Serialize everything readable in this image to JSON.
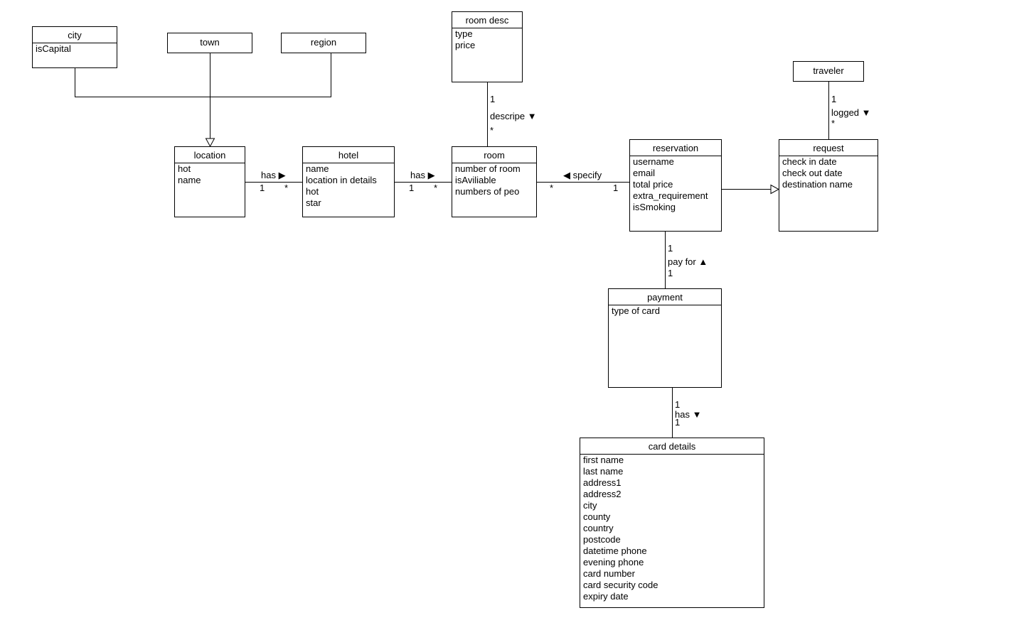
{
  "classes": {
    "city": {
      "name": "city",
      "attributes": [
        "isCapital"
      ]
    },
    "town": {
      "name": "town",
      "attributes": []
    },
    "region": {
      "name": "region",
      "attributes": []
    },
    "room_desc": {
      "name": "room desc",
      "attributes": [
        "type",
        "price"
      ]
    },
    "traveler": {
      "name": "traveler",
      "attributes": []
    },
    "location": {
      "name": "location",
      "attributes": [
        "hot",
        "name"
      ]
    },
    "hotel": {
      "name": "hotel",
      "attributes": [
        "name",
        "location in details",
        "hot",
        "star"
      ]
    },
    "room": {
      "name": "room",
      "attributes": [
        "number of room",
        "isAviliable",
        "numbers of peo"
      ]
    },
    "reservation": {
      "name": "reservation",
      "attributes": [
        "username",
        "email",
        "total price",
        "extra_requirement",
        "isSmoking"
      ]
    },
    "request": {
      "name": "request",
      "attributes": [
        "check in date",
        "check out date",
        "destination name"
      ]
    },
    "payment": {
      "name": "payment",
      "attributes": [
        "type of card"
      ]
    },
    "card_details": {
      "name": "card details",
      "attributes": [
        "first name",
        "last name",
        "address1",
        "address2",
        "city",
        "county",
        "country",
        "postcode",
        "datetime phone",
        "evening phone",
        "card number",
        "card security code",
        "expiry date"
      ]
    }
  },
  "associations": {
    "location_hotel": {
      "label": "has ▶",
      "from_mult": "1",
      "to_mult": "*"
    },
    "hotel_room": {
      "label": "has ▶",
      "from_mult": "1",
      "to_mult": "*"
    },
    "room_reservation": {
      "label": "◀ specify",
      "from_mult": "*",
      "to_mult": "1"
    },
    "roomdesc_room": {
      "label": "descripe ▼",
      "from_mult": "1",
      "to_mult": "*"
    },
    "traveler_request": {
      "label": "logged ▼",
      "from_mult": "1",
      "to_mult": "*"
    },
    "reservation_payment": {
      "label": "pay for ▲",
      "from_mult": "1",
      "to_mult": "1"
    },
    "payment_card": {
      "label": "has ▼",
      "from_mult": "1",
      "to_mult": "1"
    }
  },
  "generalizations": [
    "city → location",
    "town → location",
    "region → location",
    "reservation → request"
  ]
}
